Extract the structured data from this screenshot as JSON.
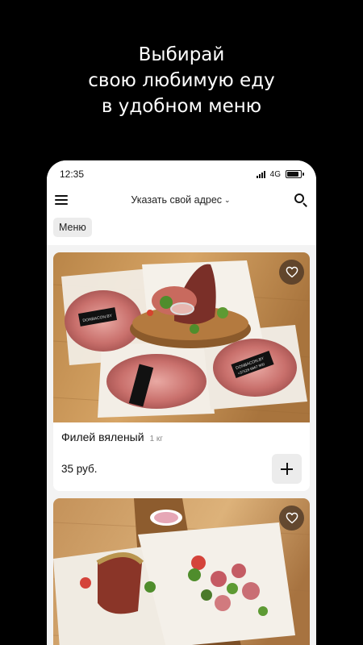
{
  "promo": {
    "line1": "Выбирай",
    "line2": "свою любимую еду",
    "line3": "в удобном меню"
  },
  "status_bar": {
    "time": "12:35",
    "network": "4G",
    "signal_bars": 4,
    "battery_level": 0.9
  },
  "app_bar": {
    "menu_icon": "hamburger-icon",
    "address_label": "Указать свой адрес",
    "address_chevron": "⌄",
    "search_icon": "search-icon"
  },
  "tabs": [
    {
      "label": "Меню",
      "selected": true
    }
  ],
  "products": [
    {
      "name": "Филей вяленый",
      "weight": "1 кг",
      "price": "35 руб.",
      "favorite_icon": "heart-outline-icon",
      "add_icon": "plus-icon",
      "package_label_1": "DONBACON.BY",
      "package_label_2": "+37529 6667 900"
    },
    {
      "favorite_icon": "heart-outline-icon"
    }
  ],
  "colors": {
    "background": "#000000",
    "surface": "#ffffff",
    "app_background": "#f3f3f3",
    "chip": "#ececec",
    "favorite_bg": "#46321f"
  }
}
